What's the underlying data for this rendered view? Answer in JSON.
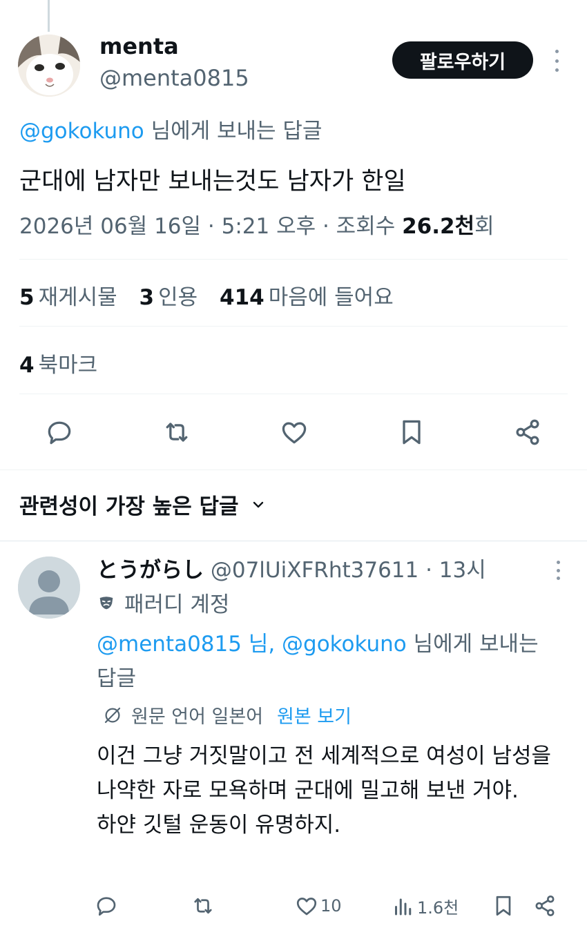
{
  "tweet": {
    "author_name": "menta",
    "author_handle": "@menta0815",
    "follow_label": "팔로우하기",
    "reply_to_handle": "@gokokuno",
    "reply_to_suffix": " 님에게 보내는 답글",
    "text": "군대에 남자만 보내는것도 남자가 한일",
    "meta_prefix": "2026년 06월 16일 · 5:21 오후 · 조회수 ",
    "views": "26.2천",
    "views_suffix": "회",
    "stats": {
      "reposts_count": "5",
      "reposts_label": "재게시물",
      "quotes_count": "3",
      "quotes_label": "인용",
      "likes_count": "414",
      "likes_label": "마음에 들어요",
      "bookmarks_count": "4",
      "bookmarks_label": "북마크"
    }
  },
  "sort_label": "관련성이 가장 높은 답글",
  "reply": {
    "author_name": "とうがらし",
    "author_handle": "@07lUiXFRht37611",
    "time": " · 13시",
    "parody_label": "패러디 계정",
    "reply_to_handles": "@menta0815 님, @gokokuno",
    "reply_to_suffix": " 님에게 보내는 답글",
    "translate_note": "원문 언어 일본어",
    "translate_link": "원본 보기",
    "text": "이건 그냥 거짓말이고 전 세계적으로 여성이 남성을 나약한 자로 모욕하며 군대에 밀고해 보낸 거야.\n하얀 깃털 운동이 유명하지.",
    "likes": "10",
    "views": "1.6천"
  },
  "colors": {
    "text": "#0f1419",
    "muted": "#536471",
    "link": "#1d9bf0",
    "button_bg": "#0f1419"
  },
  "icons": [
    "reply-icon",
    "repost-icon",
    "like-icon",
    "bookmark-icon",
    "share-icon",
    "chevron-down-icon",
    "parody-mask-icon",
    "translate-icon",
    "views-icon",
    "more-icon"
  ]
}
